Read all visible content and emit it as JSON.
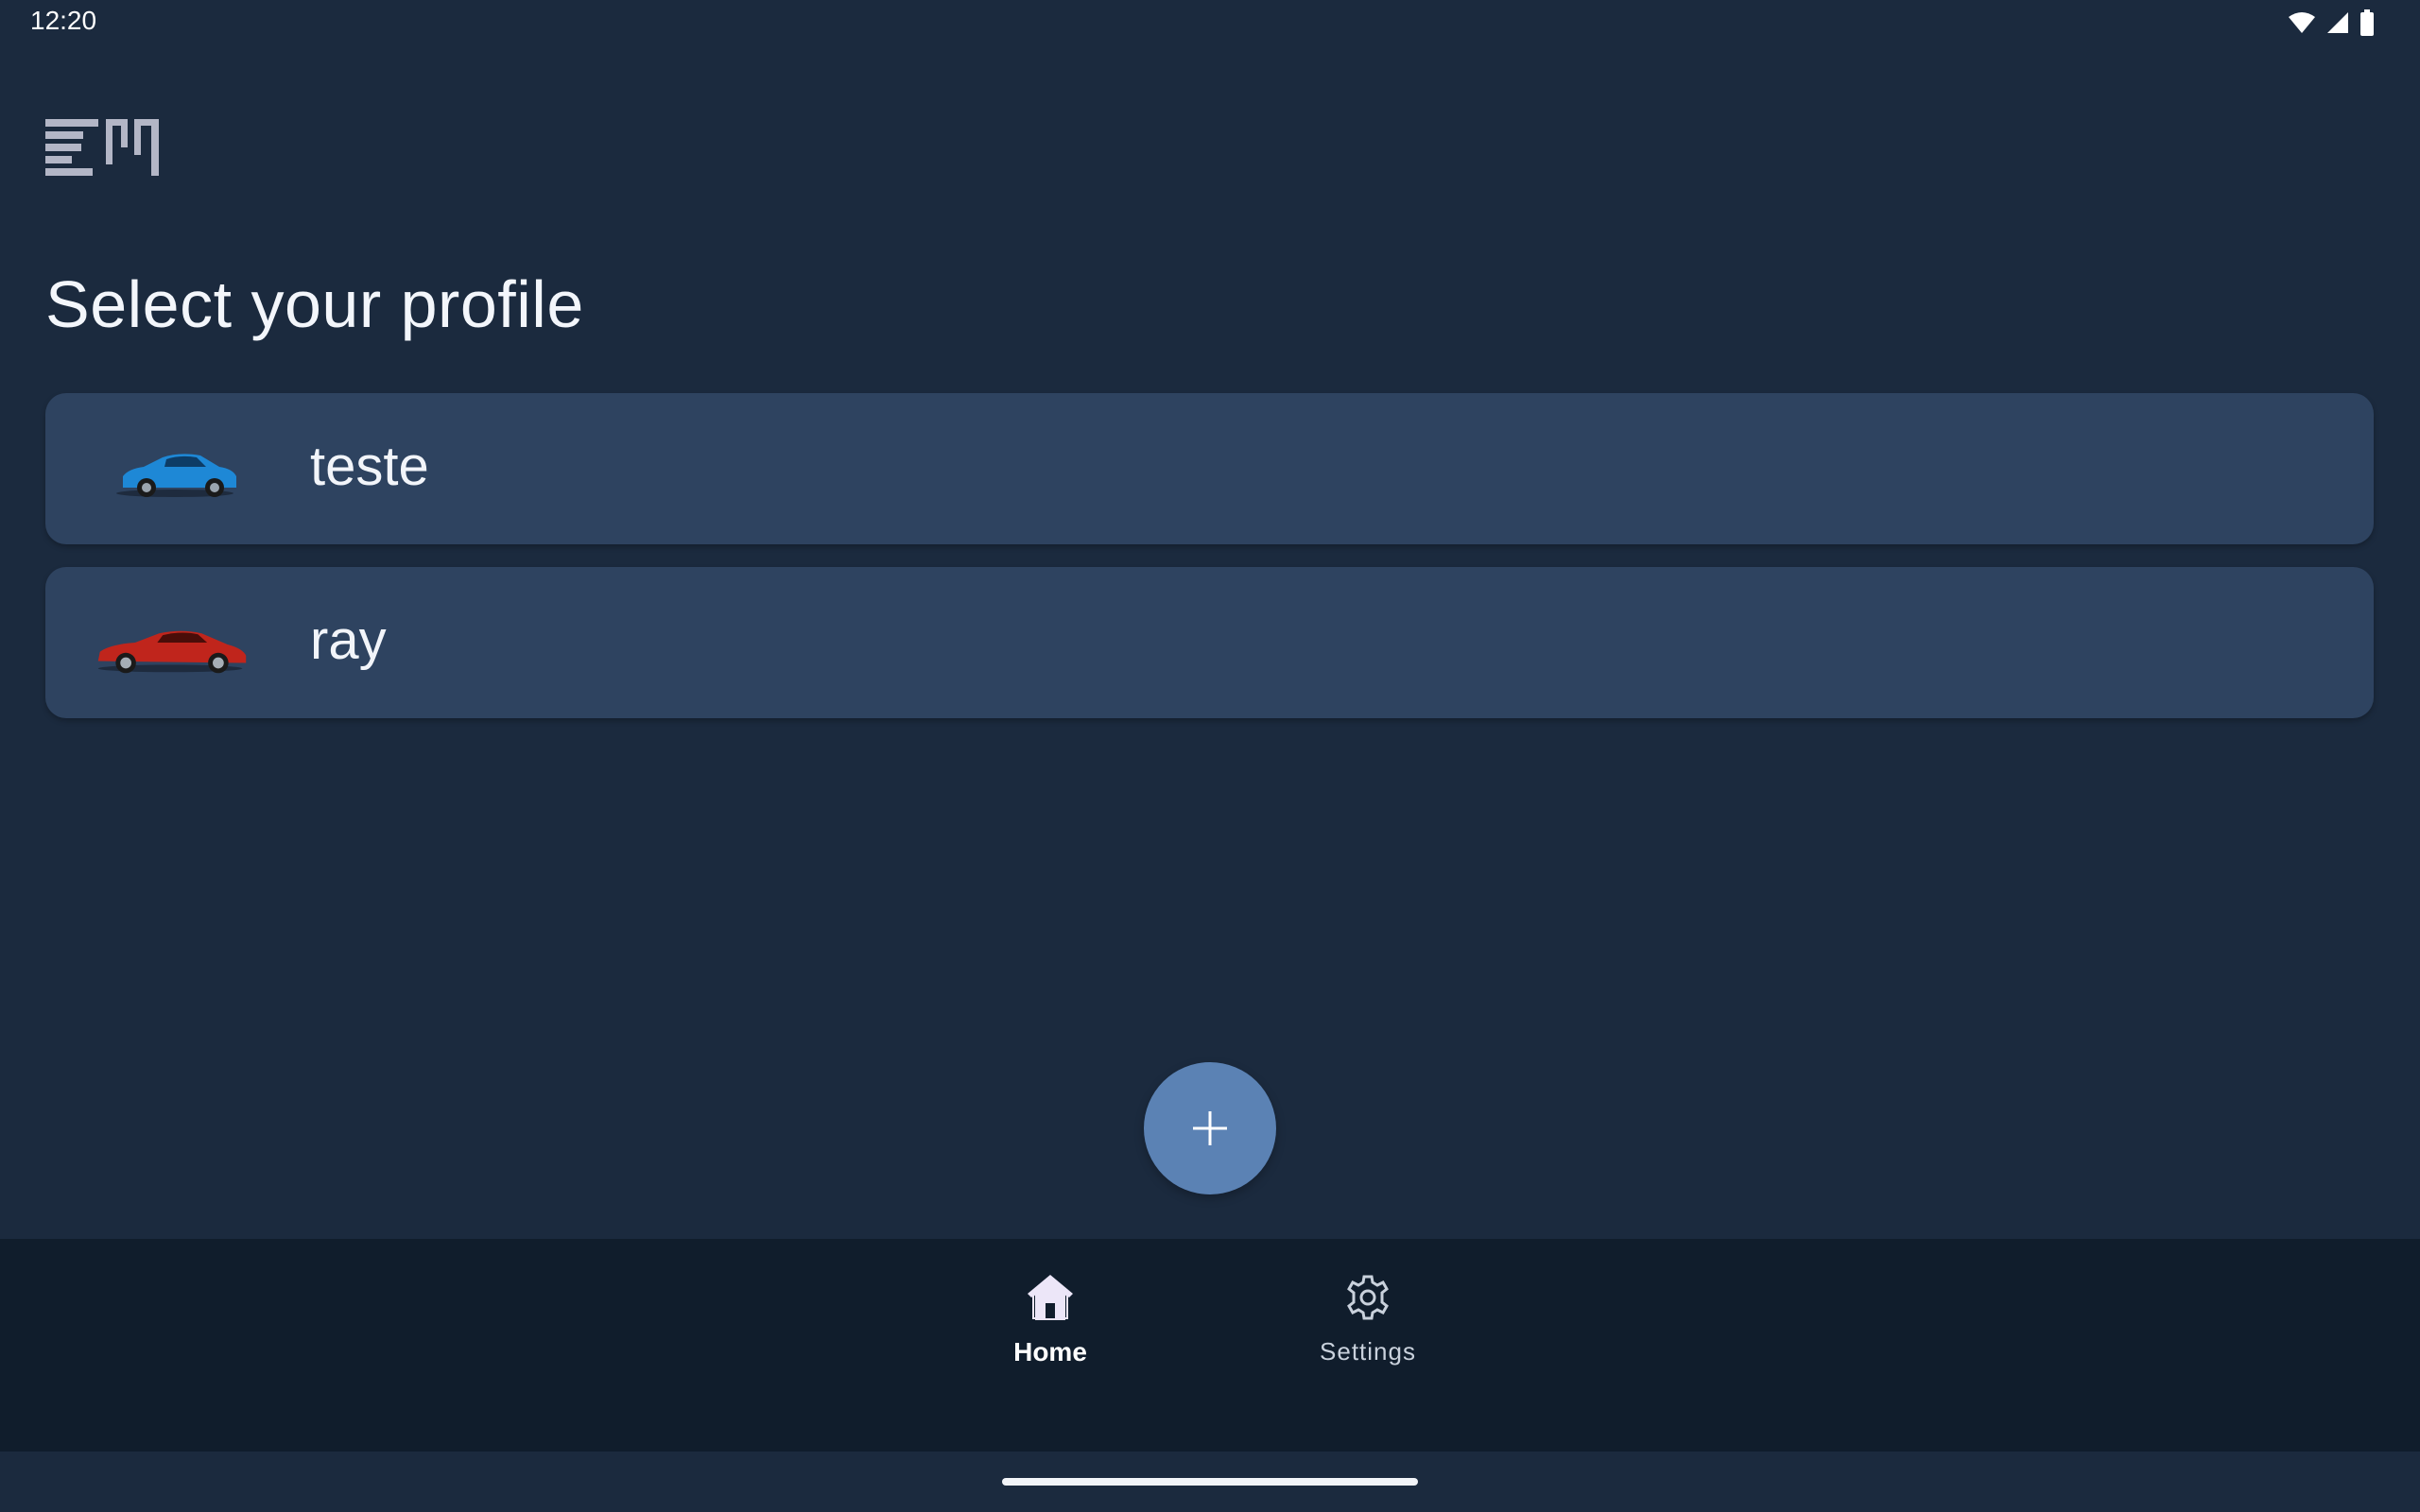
{
  "status_bar": {
    "time": "12:20",
    "icons": [
      "wifi-icon",
      "signal-icon",
      "battery-icon"
    ]
  },
  "header": {
    "logo_name": "em-logo"
  },
  "main": {
    "title": "Select your profile",
    "profiles": [
      {
        "name": "teste",
        "car_color": "#1e88d6",
        "car_icon": "car-icon-blue"
      },
      {
        "name": "ray",
        "car_color": "#c0251c",
        "car_icon": "car-icon-red"
      }
    ],
    "fab_icon": "plus-icon"
  },
  "bottom_nav": {
    "items": [
      {
        "label": "Home",
        "icon": "home-icon",
        "selected": true
      },
      {
        "label": "Settings",
        "icon": "gear-icon",
        "selected": false
      }
    ]
  },
  "colors": {
    "background": "#1b2a3e",
    "card": "#2e4360",
    "fab": "#5b82b4",
    "nav_background": "#101d2c"
  }
}
